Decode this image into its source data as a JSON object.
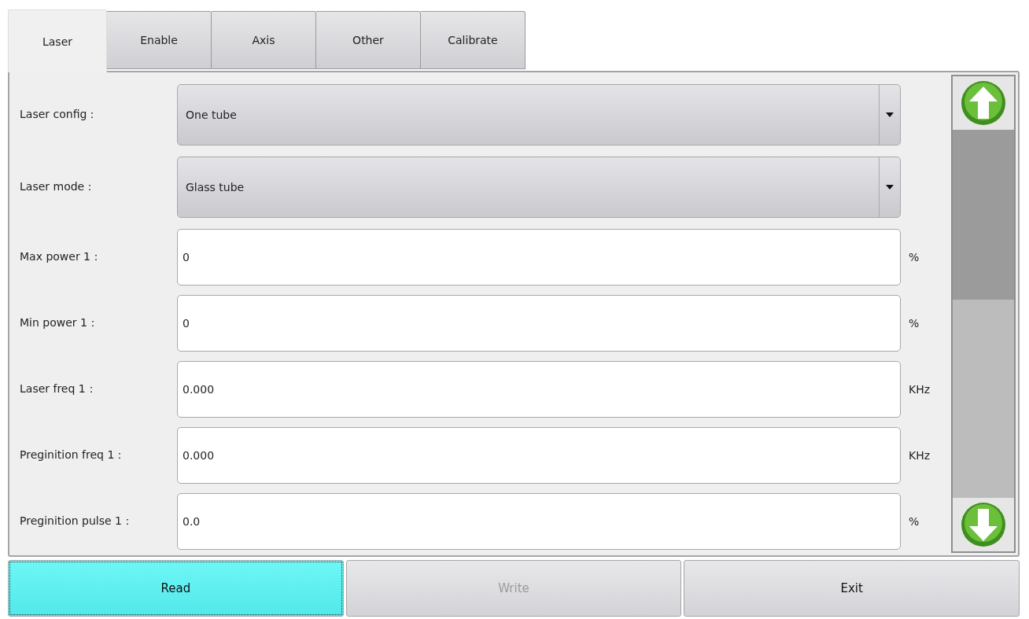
{
  "tabs": [
    {
      "label": "Laser",
      "selected": true
    },
    {
      "label": "Enable",
      "selected": false
    },
    {
      "label": "Axis",
      "selected": false
    },
    {
      "label": "Other",
      "selected": false
    },
    {
      "label": "Calibrate",
      "selected": false
    }
  ],
  "rows": [
    {
      "kind": "dropdown",
      "label": "Laser config：",
      "value": "One tube"
    },
    {
      "kind": "dropdown",
      "label": "Laser mode：",
      "value": "Glass tube"
    },
    {
      "kind": "input",
      "label": "Max power 1：",
      "value": "0",
      "unit": "%"
    },
    {
      "kind": "input",
      "label": "Min power 1：",
      "value": "0",
      "unit": "%"
    },
    {
      "kind": "input",
      "label": "Laser freq 1：",
      "value": "0.000",
      "unit": "KHz"
    },
    {
      "kind": "input",
      "label": "Preginition freq 1：",
      "value": "0.000",
      "unit": "KHz"
    },
    {
      "kind": "input",
      "label": "Preginition pulse 1：",
      "value": "0.0",
      "unit": "%"
    }
  ],
  "buttons": [
    {
      "label": "Read",
      "focused": true,
      "disabled": false
    },
    {
      "label": "Write",
      "focused": false,
      "disabled": true
    },
    {
      "label": "Exit",
      "focused": false,
      "disabled": false
    }
  ]
}
